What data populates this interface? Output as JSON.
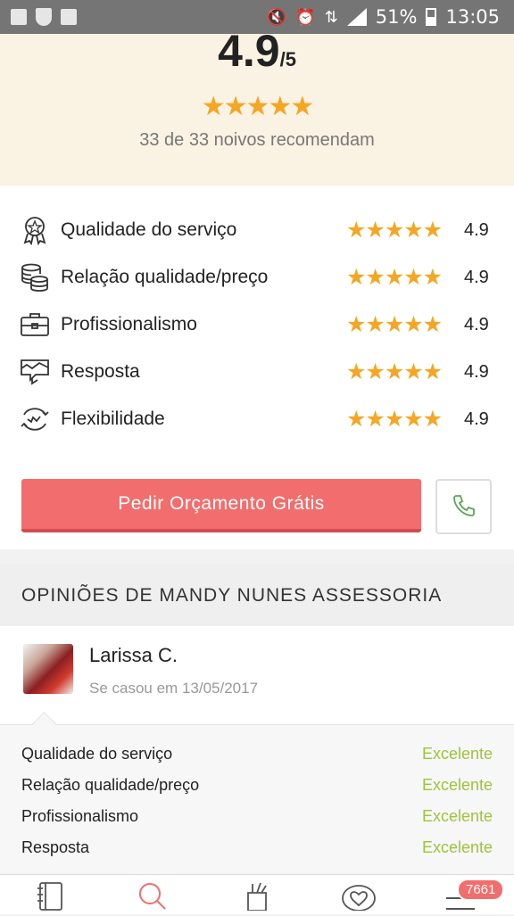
{
  "status_bar": {
    "battery_percent": "51%",
    "time": "13:05",
    "left_icons": [
      "image-icon",
      "shield-icon",
      "recycle-icon"
    ],
    "right_icons": [
      "mute-icon",
      "alarm-icon",
      "data-icon",
      "signal-icon",
      "battery-icon"
    ]
  },
  "rating": {
    "score": "4.9",
    "out_of": "/5",
    "stars": "★★★★★",
    "recommend_text": "33 de 33 noivos recomendam"
  },
  "criteria": [
    {
      "label": "Qualidade do serviço",
      "stars": "★★★★★",
      "score": "4.9",
      "icon": "award-icon"
    },
    {
      "label": "Relação qualidade/preço",
      "stars": "★★★★★",
      "score": "4.9",
      "icon": "coins-icon"
    },
    {
      "label": "Profissionalismo",
      "stars": "★★★★★",
      "score": "4.9",
      "icon": "briefcase-icon"
    },
    {
      "label": "Resposta",
      "stars": "★★★★★",
      "score": "4.9",
      "icon": "chat-icon"
    },
    {
      "label": "Flexibilidade",
      "stars": "★★★★★",
      "score": "4.9",
      "icon": "flex-icon"
    }
  ],
  "actions": {
    "quote_label": "Pedir Orçamento Grátis",
    "phone_icon": "phone-icon"
  },
  "colors": {
    "accent": "#f26d6d",
    "star": "#f5a623",
    "positive": "#9dc43a",
    "header_bg": "#faf2e3"
  },
  "reviews": {
    "heading": "OPINIÕES DE MANDY NUNES ASSESSORIA",
    "author": "Larissa C.",
    "date": "Se casou em 13/05/2017",
    "ratings": [
      {
        "label": "Qualidade do serviço",
        "value": "Excelente"
      },
      {
        "label": "Relação qualidade/preço",
        "value": "Excelente"
      },
      {
        "label": "Profissionalismo",
        "value": "Excelente"
      },
      {
        "label": "Resposta",
        "value": "Excelente"
      }
    ]
  },
  "bottom_nav": {
    "items": [
      "notebook-icon",
      "search-icon",
      "tools-icon",
      "heart-chat-icon",
      "menu-icon"
    ],
    "badge": "7661"
  }
}
